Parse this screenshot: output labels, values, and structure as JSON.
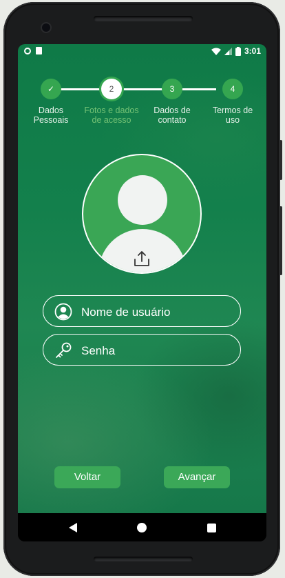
{
  "status_bar": {
    "time": "3:01"
  },
  "stepper": {
    "steps": [
      {
        "number": "✓",
        "label_line1": "Dados",
        "label_line2": "Pessoais",
        "state": "done"
      },
      {
        "number": "2",
        "label_line1": "Fotos e dados",
        "label_line2": "de acesso",
        "state": "current"
      },
      {
        "number": "3",
        "label_line1": "Dados de",
        "label_line2": "contato",
        "state": "pending"
      },
      {
        "number": "4",
        "label_line1": "Termos de",
        "label_line2": "uso",
        "state": "pending"
      }
    ]
  },
  "avatar": {
    "upload_icon": "upload-icon"
  },
  "form": {
    "username": {
      "placeholder": "Nome de usuário",
      "icon": "user-circle-icon"
    },
    "password": {
      "placeholder": "Senha",
      "icon": "key-icon"
    }
  },
  "buttons": {
    "back": "Voltar",
    "next": "Avançar"
  },
  "colors": {
    "background": "#13804c",
    "accent": "#3ba858",
    "current_step_label": "#74c275"
  }
}
